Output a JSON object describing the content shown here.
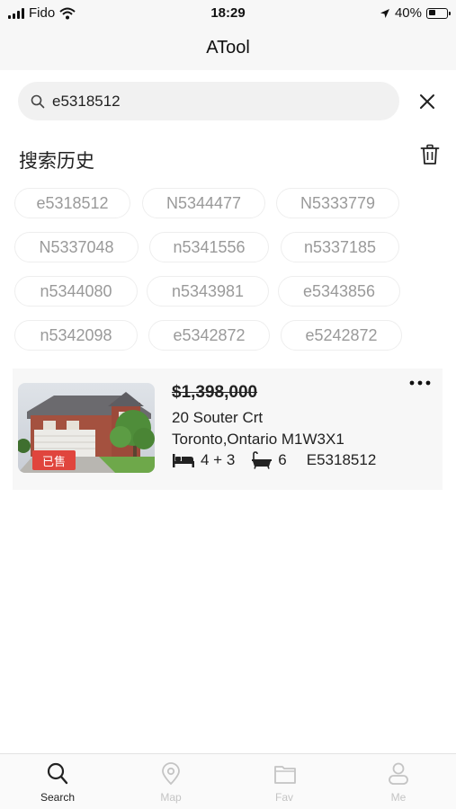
{
  "status_bar": {
    "carrier": "Fido",
    "time": "18:29",
    "battery": "40%",
    "battery_level": 0.4
  },
  "app": {
    "title": "ATool"
  },
  "search": {
    "query": "e5318512"
  },
  "history": {
    "title": "搜索历史",
    "tags": [
      "e5318512",
      "N5344477",
      "N5333779",
      "N5337048",
      "n5341556",
      "n5337185",
      "n5344080",
      "n5343981",
      "e5343856",
      "n5342098",
      "e5342872",
      "e5242872"
    ]
  },
  "listing": {
    "price": "$1,398,000",
    "address_line1": "20 Souter Crt",
    "address_line2": "Toronto,Ontario M1W3X1",
    "bedrooms": "4 + 3",
    "bathrooms": "6",
    "mls": "E5318512",
    "badge": "已售"
  },
  "tabs": [
    {
      "label": "Search",
      "icon": "search-icon",
      "active": true
    },
    {
      "label": "Map",
      "icon": "map-pin-icon",
      "active": false
    },
    {
      "label": "Fav",
      "icon": "folder-icon",
      "active": false
    },
    {
      "label": "Me",
      "icon": "user-icon",
      "active": false
    }
  ],
  "colors": {
    "sold_badge": "#e0453d",
    "tab_active": "#222222",
    "tab_inactive": "#c4c4c4",
    "tag_text": "#9a9a9a"
  }
}
